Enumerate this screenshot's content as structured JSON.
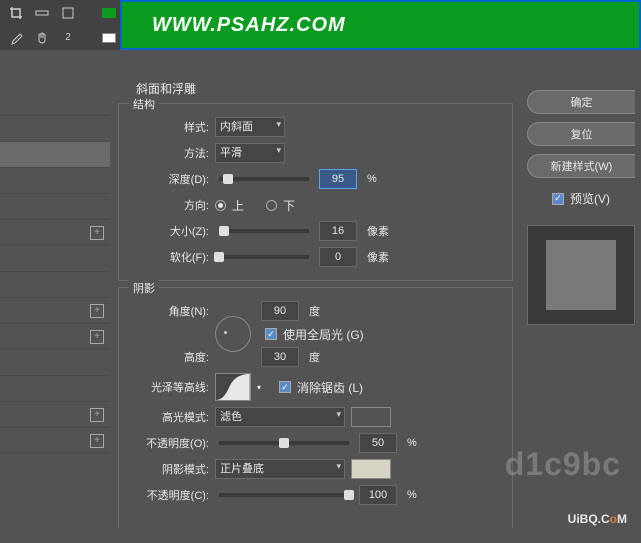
{
  "banner": {
    "url": "WWW.PSAHZ.COM"
  },
  "section": {
    "title": "斜面和浮雕",
    "structure_legend": "结构",
    "shadow_legend": "阴影"
  },
  "structure": {
    "style_label": "样式:",
    "style_value": "内斜面",
    "method_label": "方法:",
    "method_value": "平滑",
    "depth_label": "深度(D):",
    "depth_value": "95",
    "depth_unit": "%",
    "direction_label": "方向:",
    "direction_up": "上",
    "direction_down": "下",
    "size_label": "大小(Z):",
    "size_value": "16",
    "size_unit": "像素",
    "soften_label": "软化(F):",
    "soften_value": "0",
    "soften_unit": "像素"
  },
  "shadow": {
    "angle_label": "角度(N):",
    "angle_value": "90",
    "angle_unit": "度",
    "global_light_label": "使用全局光 (G)",
    "altitude_label": "高度:",
    "altitude_value": "30",
    "altitude_unit": "度",
    "contour_label": "光泽等高线:",
    "antialias_label": "消除锯齿 (L)",
    "highlight_mode_label": "高光模式:",
    "highlight_mode_value": "滤色",
    "highlight_color": "#ffffff",
    "highlight_opacity_label": "不透明度(O):",
    "highlight_opacity_value": "50",
    "highlight_opacity_unit": "%",
    "shadow_mode_label": "阴影模式:",
    "shadow_mode_value": "正片叠底",
    "shadow_color": "#d8d4c4",
    "shadow_opacity_label": "不透明度(C):",
    "shadow_opacity_value": "100",
    "shadow_opacity_unit": "%"
  },
  "buttons": {
    "ok": "确定",
    "reset": "复位",
    "new_style": "新建样式(W)",
    "preview": "预览(V)"
  },
  "watermark": {
    "code": "d1c9bc",
    "site1": "UiBQ.C",
    "site2": "o",
    "site3": "M"
  }
}
